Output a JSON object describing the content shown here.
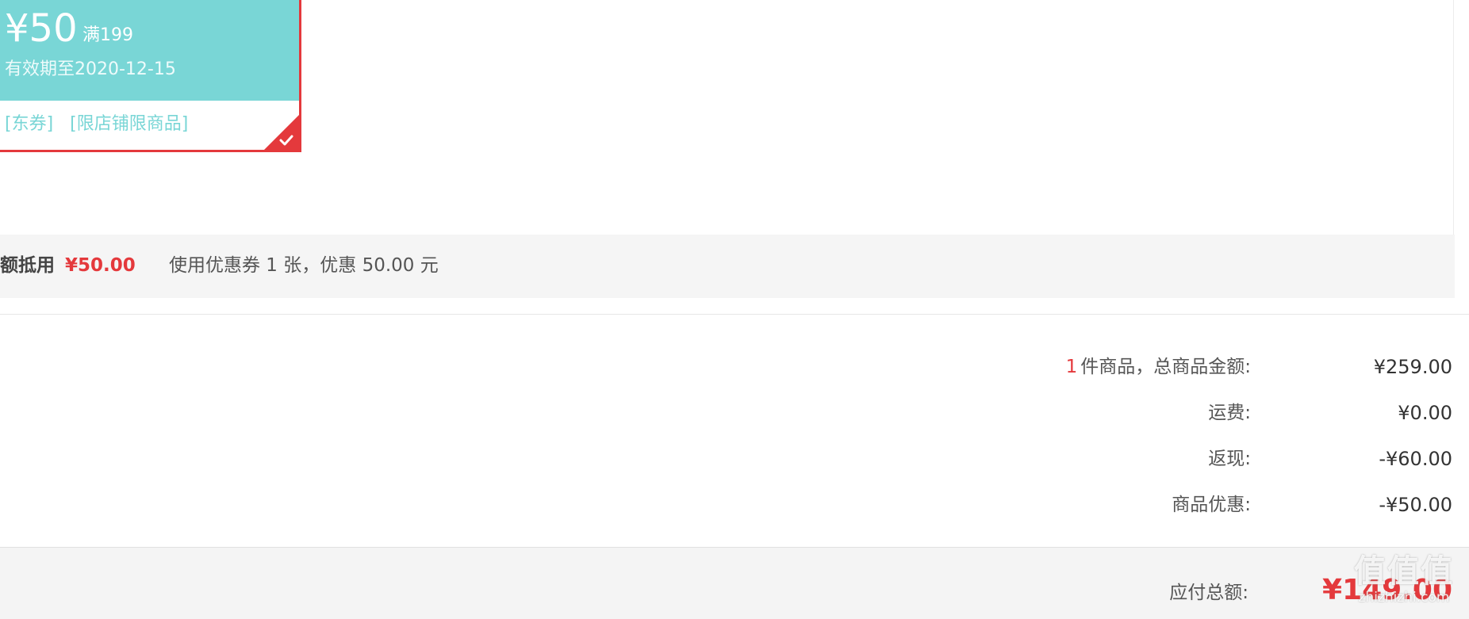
{
  "coupon": {
    "amount": "¥50",
    "threshold": "满199",
    "validity": "有效期至2020-12-15",
    "tags": [
      "[东券]",
      "[限店铺限商品]"
    ],
    "selected": true,
    "colors": {
      "card": "#79d6d6",
      "border": "#e4393c"
    }
  },
  "deduction": {
    "label": "额抵用",
    "amount": "¥50.00",
    "description": "使用优惠券 1 张，优惠 50.00 元"
  },
  "summary": {
    "item_count": "1",
    "items_label": "件商品，总商品金额:",
    "items_total": "¥259.00",
    "shipping_label": "运费:",
    "shipping_value": "¥0.00",
    "cashback_label": "返现:",
    "cashback_value": "-¥60.00",
    "discount_label": "商品优惠:",
    "discount_value": "-¥50.00"
  },
  "total": {
    "label": "应付总额:",
    "value": "¥149.00"
  },
  "watermark": {
    "logo": "值值值",
    "domain": "zhizhizhi.com"
  }
}
